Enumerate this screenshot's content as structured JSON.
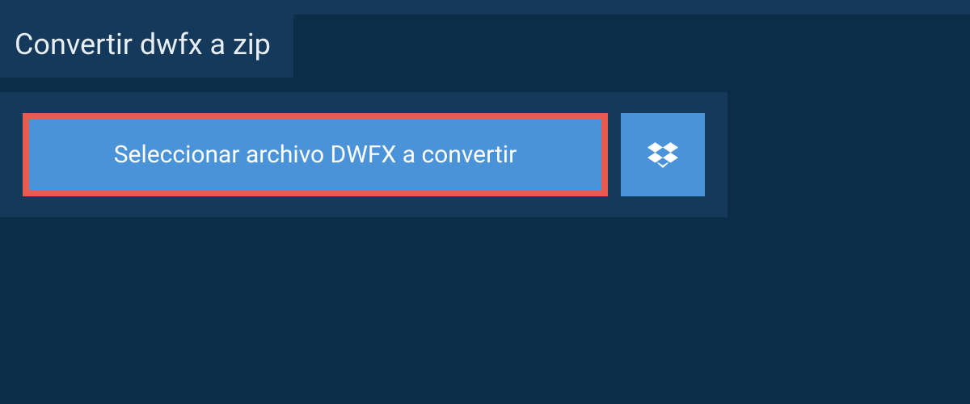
{
  "header": {
    "title": "Convertir dwfx a zip"
  },
  "upload": {
    "select_label": "Seleccionar archivo DWFX a convertir",
    "dropbox_icon": "dropbox-icon"
  },
  "colors": {
    "bg_dark": "#0c2d48",
    "bg_panel": "#14395a",
    "button_blue": "#4a93d9",
    "highlight_red": "#e85c50",
    "text_light": "#e8eef5"
  }
}
